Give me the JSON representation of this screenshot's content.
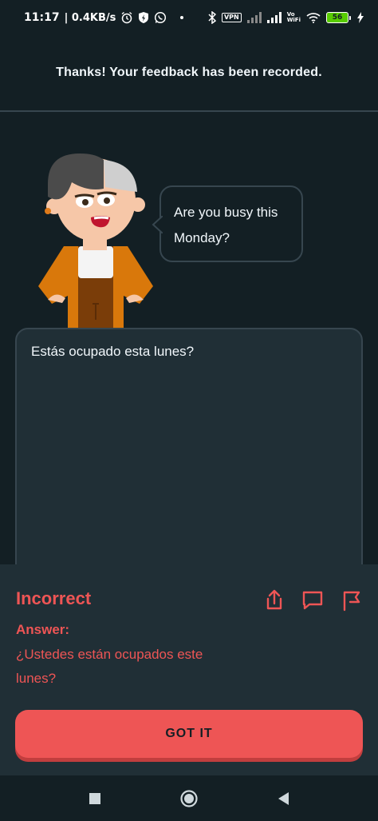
{
  "status_bar": {
    "time": "11:17",
    "speed": "| 0.4KB/s",
    "vpn": "VPN",
    "vowifi_top": "Vo",
    "vowifi_bottom": "WiFi",
    "battery": "56",
    "icons": [
      "alarm-icon",
      "shield-bolt-icon",
      "whatsapp-icon",
      "dot-icon",
      "bluetooth-icon",
      "vpn-icon",
      "signal-icon",
      "signal-icon",
      "vowifi-icon",
      "wifi-icon",
      "battery-icon",
      "charging-icon"
    ]
  },
  "feedback": {
    "message": "Thanks! Your feedback has been recorded."
  },
  "prompt": {
    "sentence": "Are you busy this Monday?"
  },
  "answer_input": {
    "value": "Estás ocupado esta lunes?"
  },
  "result": {
    "title": "Incorrect",
    "answer_label": "Answer:",
    "answer_value": "¿Ustedes están ocupados este lunes?",
    "actions": [
      "share-icon",
      "comment-icon",
      "report-flag-icon"
    ],
    "button_label": "GOT IT",
    "accent": "#ee5555"
  },
  "nav": {
    "icons": [
      "recent-apps-icon",
      "home-icon",
      "back-icon"
    ]
  }
}
